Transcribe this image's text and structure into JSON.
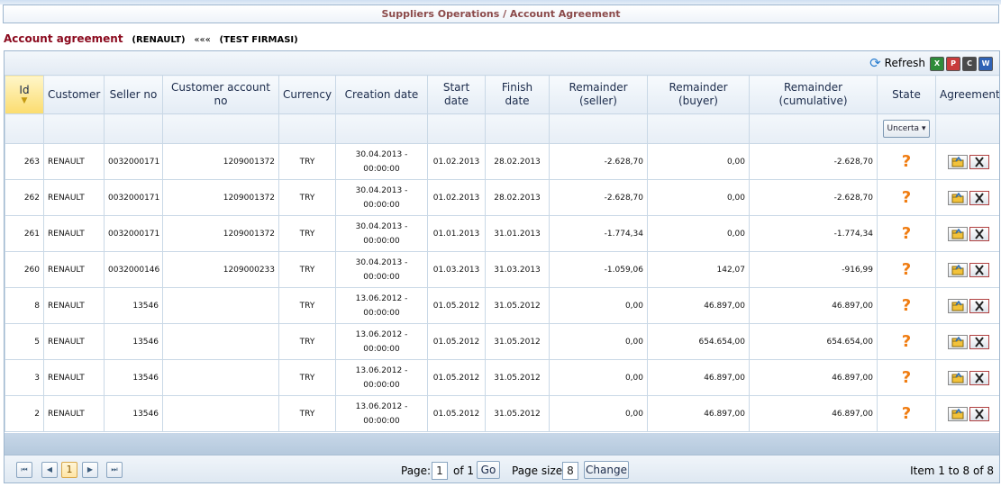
{
  "breadcrumb": "Suppliers Operations / Account Agreement",
  "heading": {
    "title": "Account agreement",
    "customer": "(RENAULT)",
    "separator": "«««",
    "firm": "(TEST FIRMASI)"
  },
  "toolbar": {
    "refresh_label": "Refresh",
    "separator": "|",
    "export_icons": [
      "excel-export-icon",
      "pdf-export-icon",
      "csv-export-icon",
      "word-export-icon"
    ]
  },
  "columns": {
    "id": "Id",
    "customer": "Customer",
    "seller_no": "Seller no",
    "customer_account_no": "Customer account no",
    "currency": "Currency",
    "creation_date": "Creation date",
    "start_date": "Start date",
    "finish_date": "Finish date",
    "remainder_seller": "Remainder (seller)",
    "remainder_buyer": "Remainder (buyer)",
    "remainder_cumulative": "Remainder (cumulative)",
    "state": "State",
    "agreement": "Agreement"
  },
  "filter": {
    "state_value": "Uncerta"
  },
  "rows": [
    {
      "id": "263",
      "customer": "RENAULT",
      "seller_no": "0032000171",
      "account_no": "1209001372",
      "currency": "TRY",
      "creation_date": "30.04.2013 -",
      "creation_time": "00:00:00",
      "start": "01.02.2013",
      "finish": "28.02.2013",
      "rem_seller": "-2.628,70",
      "rem_buyer": "0,00",
      "rem_cum": "-2.628,70",
      "state": "?"
    },
    {
      "id": "262",
      "customer": "RENAULT",
      "seller_no": "0032000171",
      "account_no": "1209001372",
      "currency": "TRY",
      "creation_date": "30.04.2013 -",
      "creation_time": "00:00:00",
      "start": "01.02.2013",
      "finish": "28.02.2013",
      "rem_seller": "-2.628,70",
      "rem_buyer": "0,00",
      "rem_cum": "-2.628,70",
      "state": "?"
    },
    {
      "id": "261",
      "customer": "RENAULT",
      "seller_no": "0032000171",
      "account_no": "1209001372",
      "currency": "TRY",
      "creation_date": "30.04.2013 -",
      "creation_time": "00:00:00",
      "start": "01.01.2013",
      "finish": "31.01.2013",
      "rem_seller": "-1.774,34",
      "rem_buyer": "0,00",
      "rem_cum": "-1.774,34",
      "state": "?"
    },
    {
      "id": "260",
      "customer": "RENAULT",
      "seller_no": "0032000146",
      "account_no": "1209000233",
      "currency": "TRY",
      "creation_date": "30.04.2013 -",
      "creation_time": "00:00:00",
      "start": "01.03.2013",
      "finish": "31.03.2013",
      "rem_seller": "-1.059,06",
      "rem_buyer": "142,07",
      "rem_cum": "-916,99",
      "state": "?"
    },
    {
      "id": "8",
      "customer": "RENAULT",
      "seller_no": "13546",
      "account_no": "",
      "currency": "TRY",
      "creation_date": "13.06.2012 -",
      "creation_time": "00:00:00",
      "start": "01.05.2012",
      "finish": "31.05.2012",
      "rem_seller": "0,00",
      "rem_buyer": "46.897,00",
      "rem_cum": "46.897,00",
      "state": "?"
    },
    {
      "id": "5",
      "customer": "RENAULT",
      "seller_no": "13546",
      "account_no": "",
      "currency": "TRY",
      "creation_date": "13.06.2012 -",
      "creation_time": "00:00:00",
      "start": "01.05.2012",
      "finish": "31.05.2012",
      "rem_seller": "0,00",
      "rem_buyer": "654.654,00",
      "rem_cum": "654.654,00",
      "state": "?"
    },
    {
      "id": "3",
      "customer": "RENAULT",
      "seller_no": "13546",
      "account_no": "",
      "currency": "TRY",
      "creation_date": "13.06.2012 -",
      "creation_time": "00:00:00",
      "start": "01.05.2012",
      "finish": "31.05.2012",
      "rem_seller": "0,00",
      "rem_buyer": "46.897,00",
      "rem_cum": "46.897,00",
      "state": "?"
    },
    {
      "id": "2",
      "customer": "RENAULT",
      "seller_no": "13546",
      "account_no": "",
      "currency": "TRY",
      "creation_date": "13.06.2012 -",
      "creation_time": "00:00:00",
      "start": "01.05.2012",
      "finish": "31.05.2012",
      "rem_seller": "0,00",
      "rem_buyer": "46.897,00",
      "rem_cum": "46.897,00",
      "state": "?"
    }
  ],
  "pager": {
    "current_page": "1",
    "page_label": "Page:",
    "page_value": "1",
    "of_label": "of 1",
    "go_label": "Go",
    "page_size_label": "Page size:",
    "page_size_value": "8",
    "change_label": "Change",
    "info": "Item 1 to 8 of 8"
  },
  "colors": {
    "title_red": "#8b0a1e",
    "breadcrumb_text": "#8b4a4a",
    "header_blue": "#e4ecf5",
    "state_orange": "#f07d12",
    "sorted_header": "#fbdc6e"
  }
}
